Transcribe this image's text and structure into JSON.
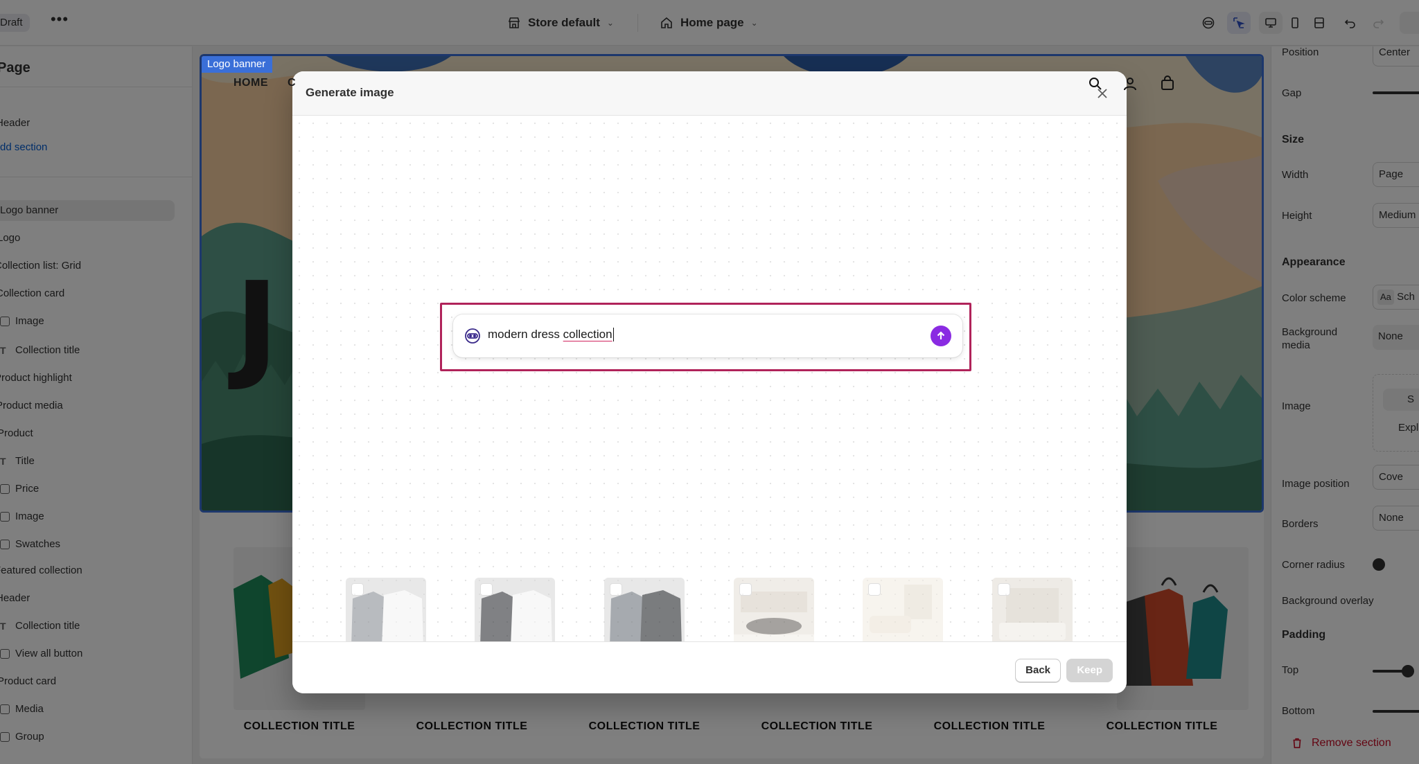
{
  "topbar": {
    "status_badge": "Draft",
    "store_select": "Store default",
    "page_select": "Home page"
  },
  "left_sidebar": {
    "heading": "Page",
    "items": [
      {
        "label": "Header",
        "icon": "none"
      },
      {
        "label": "Add section",
        "icon": "none",
        "link": true
      },
      {
        "label": "Logo banner",
        "icon": "section-icon",
        "selected": true
      },
      {
        "label": "Logo",
        "icon": "block-icon"
      },
      {
        "label": "Collection list: Grid",
        "icon": "section-icon"
      },
      {
        "label": "Collection card",
        "icon": "block-icon"
      },
      {
        "label": "Image",
        "icon": "image-icon"
      },
      {
        "label": "Collection title",
        "icon": "text-icon"
      },
      {
        "label": "Product highlight",
        "icon": "section-icon"
      },
      {
        "label": "Product media",
        "icon": "block-icon"
      },
      {
        "label": "Product",
        "icon": "block-icon"
      },
      {
        "label": "Title",
        "icon": "text-icon"
      },
      {
        "label": "Price",
        "icon": "price-icon"
      },
      {
        "label": "Image",
        "icon": "image-icon"
      },
      {
        "label": "Swatches",
        "icon": "swatch-icon"
      },
      {
        "label": "Featured collection",
        "icon": "section-icon"
      },
      {
        "label": "Header",
        "icon": "block-icon"
      },
      {
        "label": "Collection title",
        "icon": "text-icon"
      },
      {
        "label": "View all button",
        "icon": "button-icon"
      },
      {
        "label": "Product card",
        "icon": "block-icon"
      },
      {
        "label": "Media",
        "icon": "image-icon"
      },
      {
        "label": "Group",
        "icon": "group-icon"
      }
    ]
  },
  "preview": {
    "section_label": "Logo banner",
    "nav_home": "HOME",
    "nav_partial": "C",
    "big_letter": "J",
    "collection_titles": [
      "COLLECTION TITLE",
      "COLLECTION TITLE",
      "COLLECTION TITLE",
      "COLLECTION TITLE",
      "COLLECTION TITLE",
      "COLLECTION TITLE"
    ]
  },
  "right_sidebar": {
    "position_label": "Position",
    "position_value": "Center",
    "gap_label": "Gap",
    "size_heading": "Size",
    "width_label": "Width",
    "width_value": "Page",
    "height_label": "Height",
    "height_value": "Medium",
    "appearance_heading": "Appearance",
    "color_scheme_label": "Color scheme",
    "color_scheme_value": "Sch",
    "color_scheme_swatch": "Aa",
    "background_media_label": "Background media",
    "background_media_value": "None",
    "image_label": "Image",
    "image_select": "S",
    "image_explore": "Expl",
    "image_position_label": "Image position",
    "image_position_value": "Cove",
    "borders_label": "Borders",
    "borders_value": "None",
    "corner_radius_label": "Corner radius",
    "background_overlay_label": "Background overlay",
    "padding_heading": "Padding",
    "top_label": "Top",
    "bottom_label": "Bottom",
    "remove_section": "Remove section"
  },
  "modal": {
    "title": "Generate image",
    "prompt_text_plain": "modern dress ",
    "prompt_text_misspelled": "collection",
    "back_label": "Back",
    "keep_label": "Keep"
  },
  "colors": {
    "accent_purple": "#8a2be2",
    "highlight_border": "#b0235a",
    "selection_blue": "#3a6fd8",
    "destructive_red": "#c70a24"
  }
}
